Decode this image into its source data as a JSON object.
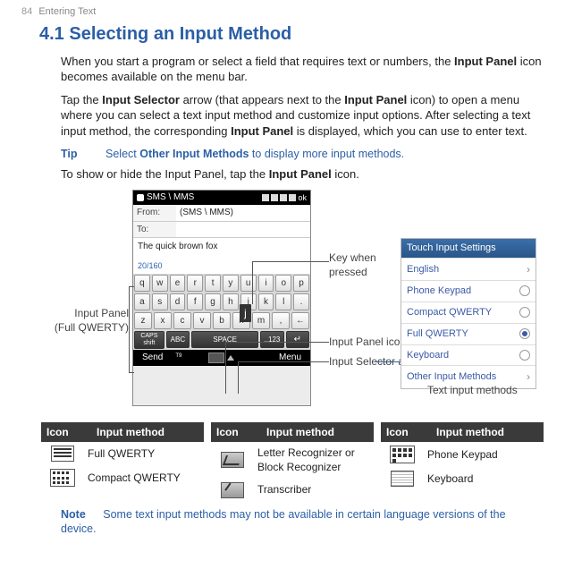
{
  "header": {
    "page_number": "84",
    "chapter": "Entering Text"
  },
  "section_title": "4.1 Selecting an Input Method",
  "para1_a": "When you start a program or select a field that requires text or numbers, the ",
  "para1_b": "Input Panel",
  "para1_c": " icon becomes available on the menu bar.",
  "para2_a": "Tap the ",
  "para2_b": "Input Selector",
  "para2_c": " arrow (that appears next to the ",
  "para2_d": "Input Panel",
  "para2_e": " icon) to open a menu where you can select a text input method and customize input options. After selecting a text input method, the corresponding ",
  "para2_f": "Input Panel",
  "para2_g": " is displayed, which you can use to enter text.",
  "tip": {
    "label": "Tip",
    "text_a": "Select ",
    "text_b": "Other Input Methods",
    "text_c": " to display more input methods."
  },
  "para3_a": "To show or hide the Input Panel, tap the ",
  "para3_b": "Input Panel",
  "para3_c": " icon.",
  "callouts": {
    "left1": "Input Panel",
    "left2": "(Full QWERTY)",
    "key_pressed": "Key when pressed",
    "panel_icon": "Input Panel icon",
    "selector_arrow": "Input Selector arrow",
    "panel_caption": "Text input methods"
  },
  "phone": {
    "title": "SMS \\ MMS",
    "ok": "ok",
    "from_label": "From:",
    "from_value": "(SMS \\ MMS)",
    "to_label": "To:",
    "to_value": "",
    "editor_text": "The quick brown fox",
    "counter": "20/160",
    "rows": [
      [
        "q",
        "w",
        "e",
        "r",
        "t",
        "y",
        "u",
        "i",
        "o",
        "p"
      ],
      [
        "a",
        "s",
        "d",
        "f",
        "g",
        "h",
        "j",
        "k",
        "l",
        "."
      ],
      [
        "z",
        "x",
        "c",
        "v",
        "b",
        "n",
        "m",
        ",",
        "←"
      ]
    ],
    "bottom_keys": {
      "caps1": "CAPS",
      "caps2": "shift",
      "abc": "ABC",
      "t9": "T9",
      "space": "SPACE",
      "sym": "..123"
    },
    "softkeys": {
      "left": "Send",
      "right": "Menu"
    }
  },
  "methods_panel": {
    "header": "Touch Input Settings",
    "items": [
      {
        "label": "English",
        "type": "chev"
      },
      {
        "label": "Phone Keypad",
        "type": "radio"
      },
      {
        "label": "Compact QWERTY",
        "type": "radio"
      },
      {
        "label": "Full QWERTY",
        "type": "radio-sel"
      },
      {
        "label": "Keyboard",
        "type": "radio"
      },
      {
        "label": "Other Input Methods",
        "type": "chev"
      }
    ]
  },
  "tables": {
    "headers": {
      "icon": "Icon",
      "method": "Input method"
    },
    "col1": [
      {
        "label": "Full QWERTY",
        "icon": "lines"
      },
      {
        "label": "Compact QWERTY",
        "icon": "squares"
      }
    ],
    "col2": [
      {
        "label": "Letter Recognizer or Block Recognizer",
        "icon": "diag"
      },
      {
        "label": "Transcriber",
        "icon": "pen"
      }
    ],
    "col3": [
      {
        "label": "Phone Keypad",
        "icon": "grid"
      },
      {
        "label": "Keyboard",
        "icon": "hatch"
      }
    ]
  },
  "note": {
    "label": "Note",
    "text": "Some text input methods may not be available in certain language versions of the device."
  }
}
